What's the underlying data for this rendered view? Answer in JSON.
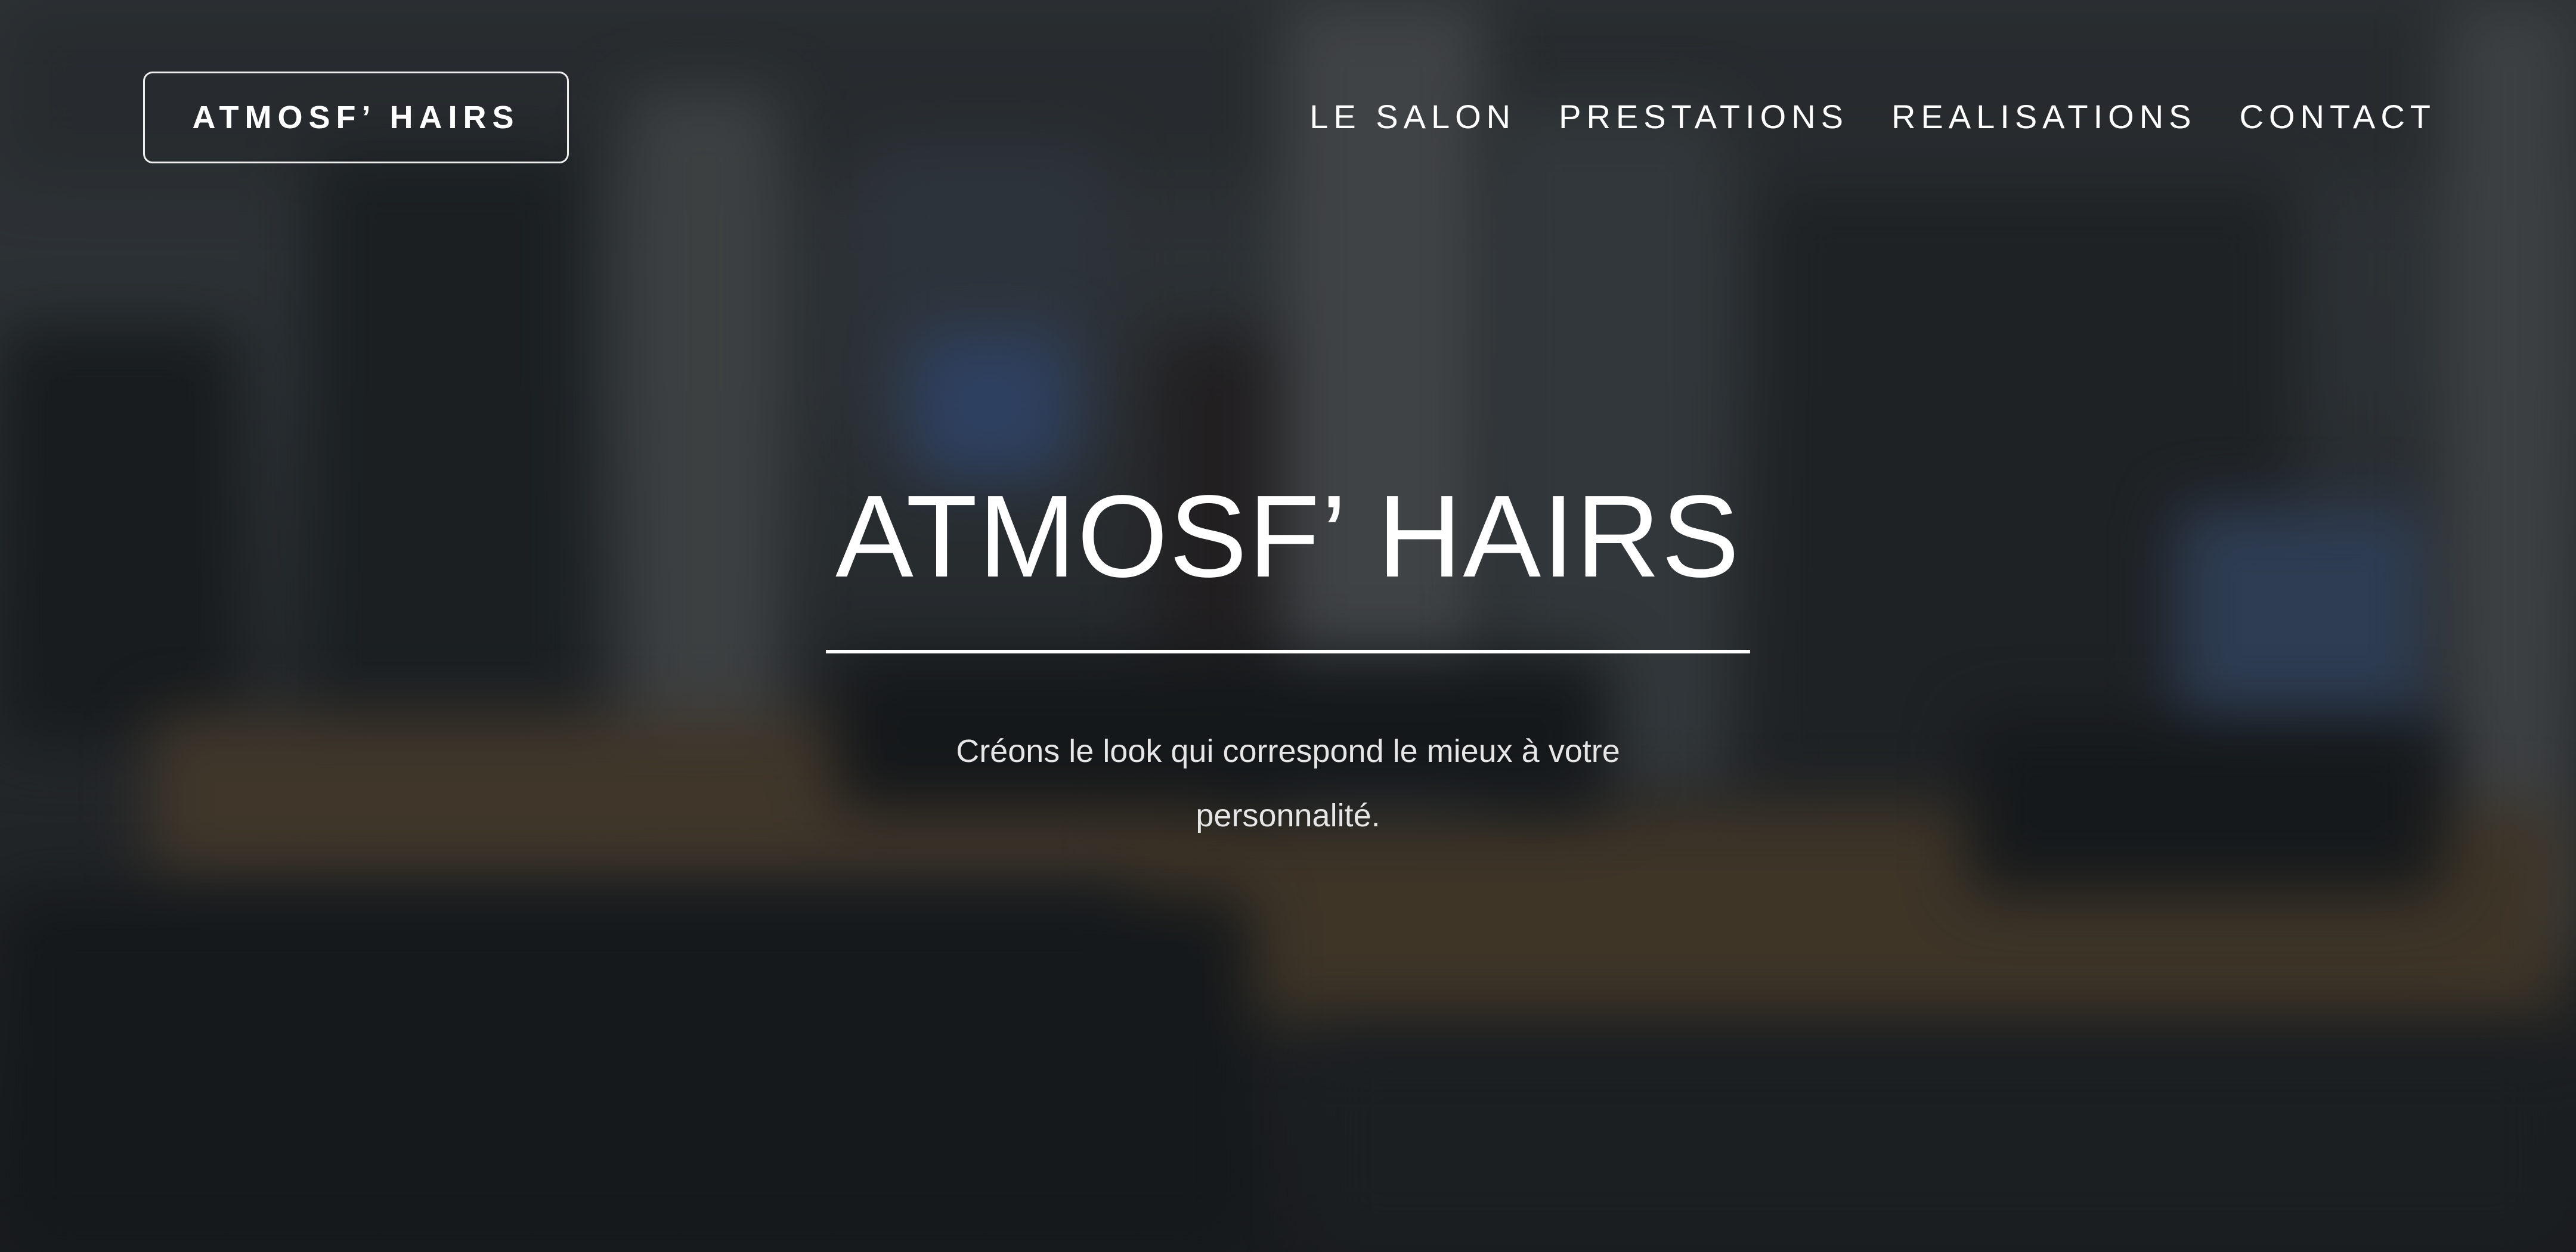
{
  "header": {
    "logo_text": "ATMOSF’ HAIRS",
    "nav": [
      {
        "label": "LE SALON"
      },
      {
        "label": "PRESTATIONS"
      },
      {
        "label": "REALISATIONS"
      },
      {
        "label": "CONTACT"
      }
    ]
  },
  "hero": {
    "title": "ATMOSF’ HAIRS",
    "subtitle": "Créons le look qui correspond le mieux à votre personnalité."
  },
  "colors": {
    "text": "#ffffff",
    "subtitle_text": "#e6e6e6",
    "background": "#2f3437"
  }
}
